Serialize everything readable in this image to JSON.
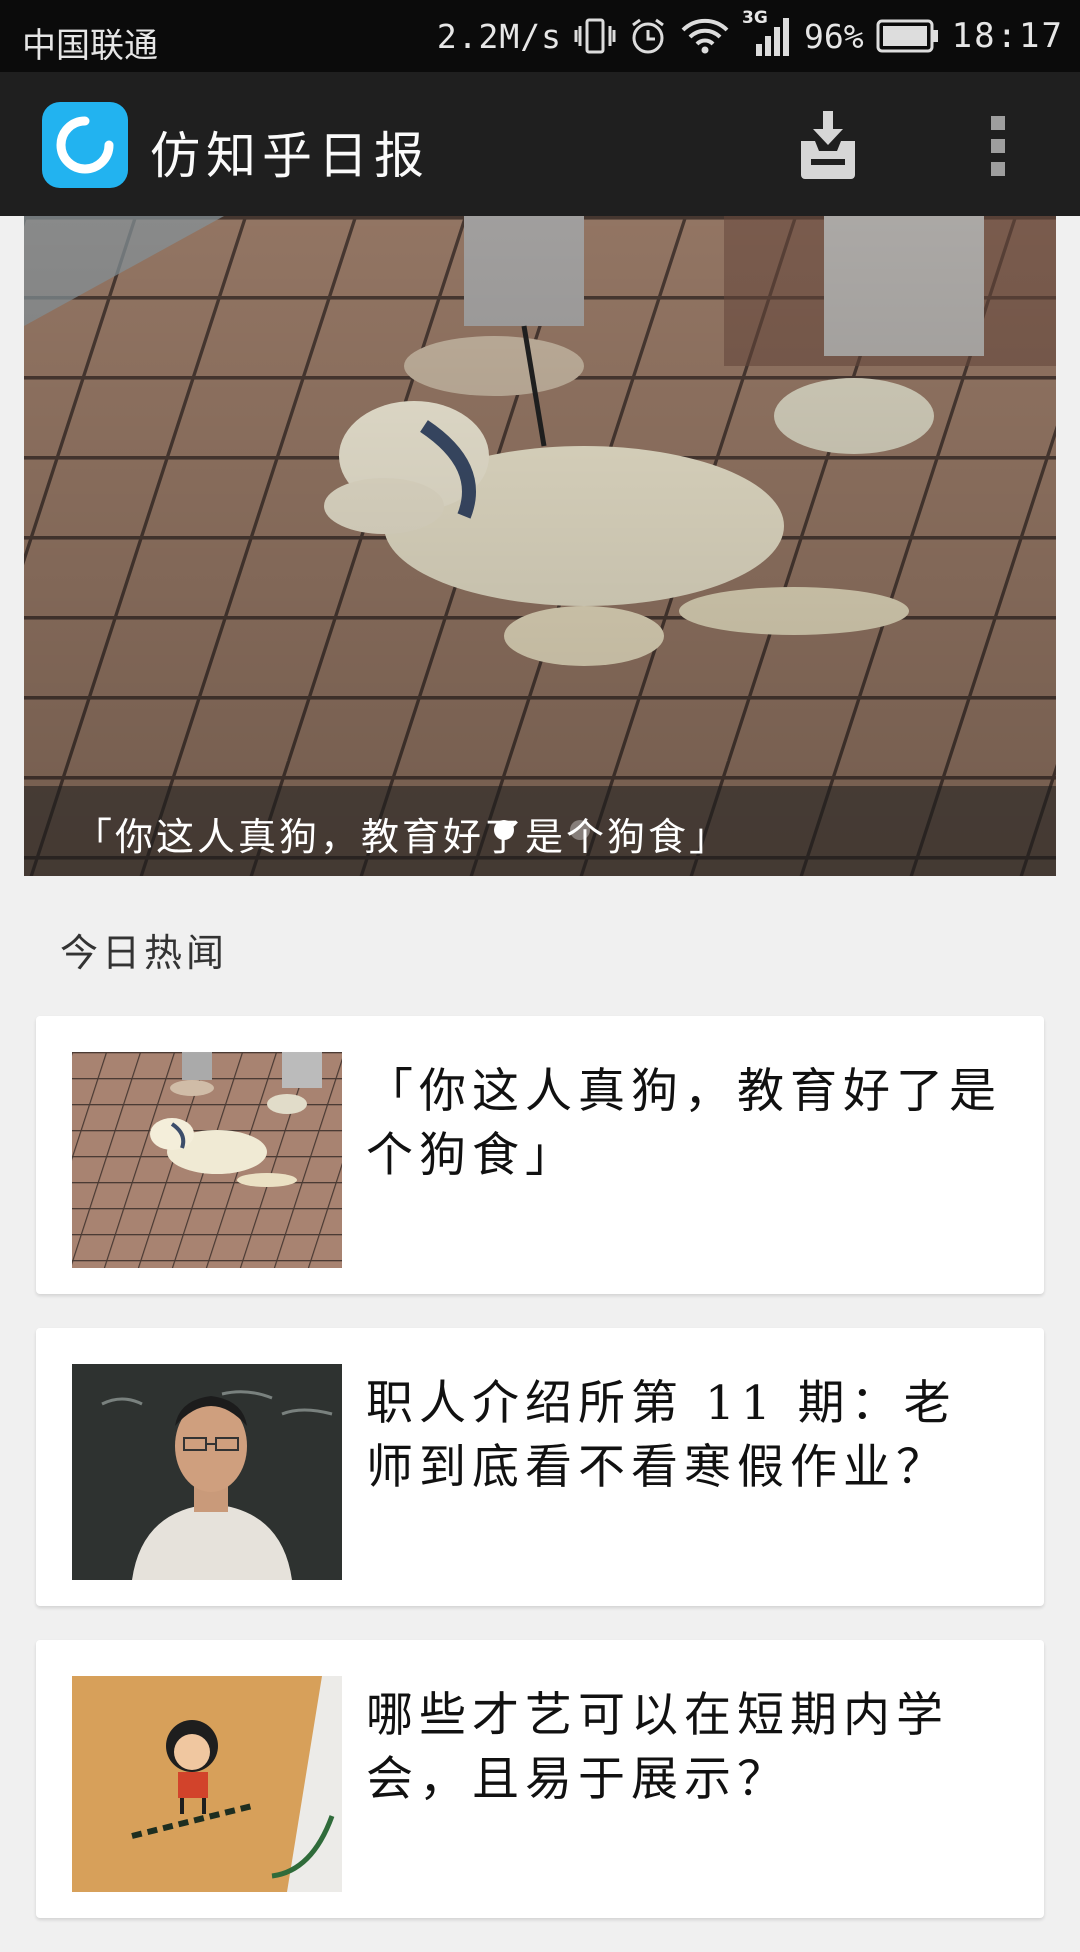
{
  "status_bar": {
    "carrier": "中国联通",
    "network_speed": "2.2M/s",
    "network_type": "3G",
    "battery_percent": "96%",
    "time": "18:17",
    "icons": [
      "vibrate-icon",
      "alarm-icon",
      "wifi-icon",
      "cell-signal-icon",
      "battery-icon"
    ]
  },
  "app_bar": {
    "title": "仿知乎日报",
    "logo_color": "#22b3f0",
    "actions": [
      "download-icon",
      "overflow-menu-icon"
    ]
  },
  "hero": {
    "caption": "「你这人真狗，教育好了是个狗食」",
    "active_dot_index": 0
  },
  "section": {
    "title": "今日热闻"
  },
  "stories": [
    {
      "title": "「你这人真狗，教育好了是个狗食」",
      "thumb": "dog-on-tiles-image"
    },
    {
      "title": "职人介绍所第 11 期：老师到底看不看寒假作业？",
      "thumb": "teacher-at-blackboard-image"
    },
    {
      "title": "哪些才艺可以在短期内学会，且易于展示？",
      "thumb": "cork-coaster-image"
    }
  ],
  "colors": {
    "status_bar_bg": "#0b0b0b",
    "app_bar_bg": "#1f1f1f",
    "page_bg": "#f0f0f0",
    "card_bg": "#ffffff"
  }
}
